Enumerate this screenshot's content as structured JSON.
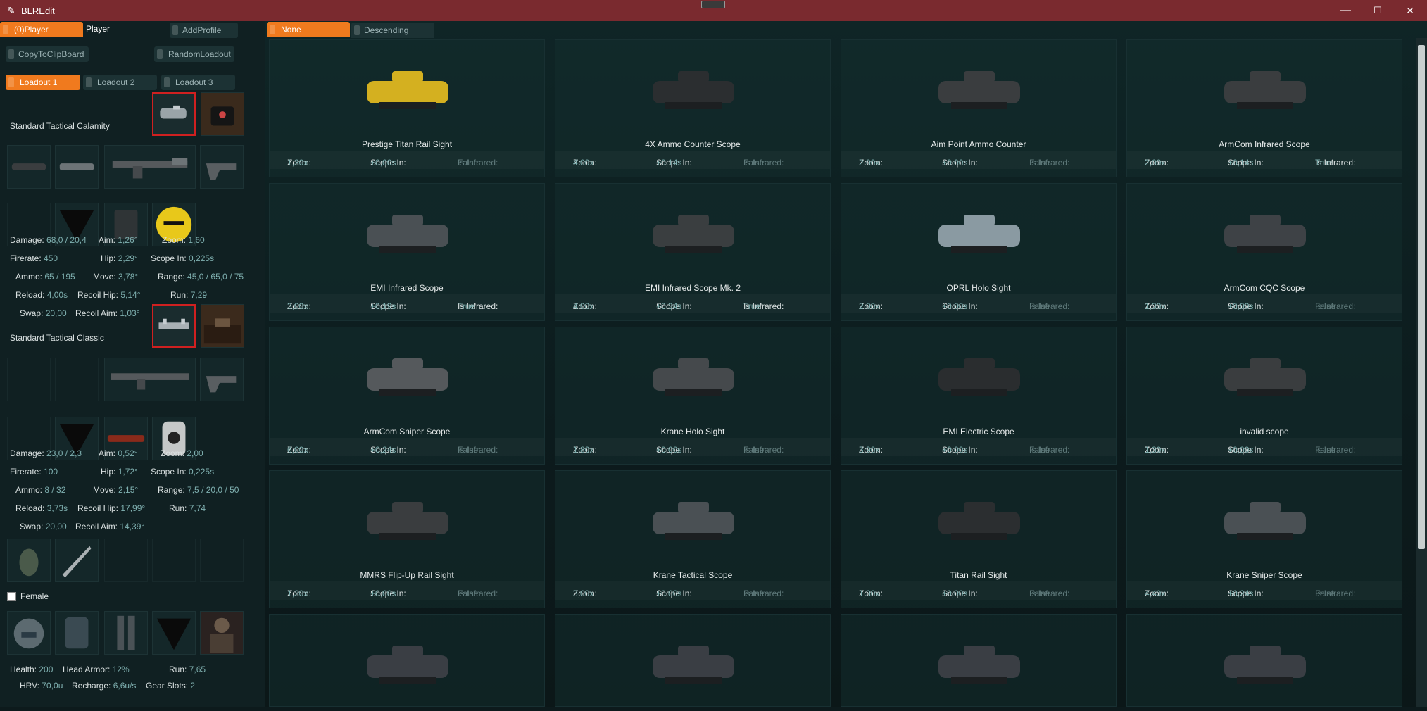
{
  "window": {
    "title": "BLREdit",
    "min": "—",
    "max": "☐",
    "close": "✕"
  },
  "left": {
    "player_tab": "(0)Player",
    "player_label": "Player",
    "add_profile": "AddProfile",
    "copy": "CopyToClipBoard",
    "random": "RandomLoadout",
    "loadouts": [
      "Loadout 1",
      "Loadout 2",
      "Loadout 3"
    ],
    "primary": {
      "name": "Standard Tactical Calamity",
      "stats": {
        "damage": "68,0 / 20,4",
        "aim": "1,26°",
        "zoom": "1,60",
        "firerate": "450",
        "hip": "2,29°",
        "scopein": "0,225s",
        "ammo": "65 / 195",
        "move": "3,78°",
        "range": "45,0 / 65,0 / 75",
        "reload": "4,00s",
        "recoilhip": "5,14°",
        "run": "7,29",
        "swap": "20,00",
        "recoilaim": "1,03°"
      }
    },
    "secondary": {
      "name": "Standard Tactical Classic",
      "stats": {
        "damage": "23,0 / 2,3",
        "aim": "0,52°",
        "zoom": "2,00",
        "firerate": "100",
        "hip": "1,72°",
        "scopein": "0,225s",
        "ammo": "8 / 32",
        "move": "2,15°",
        "range": "7,5 / 20,0 / 50",
        "reload": "3,73s",
        "recoilhip": "17,99°",
        "run": "7,74",
        "swap": "20,00",
        "recoilaim": "14,39°"
      }
    },
    "labels": {
      "damage": "Damage:",
      "aim": "Aim:",
      "zoom": "Zoom:",
      "firerate": "Firerate:",
      "hip": "Hip:",
      "scopein": "Scope In:",
      "ammo": "Ammo:",
      "move": "Move:",
      "range": "Range:",
      "reload": "Reload:",
      "recoilhip": "Recoil Hip:",
      "run": "Run:",
      "swap": "Swap:",
      "recoilaim": "Recoil Aim:",
      "health": "Health:",
      "head": "Head Armor:",
      "hrv": "HRV:",
      "recharge": "Recharge:",
      "gear": "Gear Slots:"
    },
    "female": "Female",
    "gear": {
      "health": "200",
      "head": "12%",
      "run": "7,65",
      "hrv": "70,0u",
      "recharge": "6,6u/s",
      "gearslots": "2"
    }
  },
  "right": {
    "sort": "None",
    "order": "Descending",
    "zoom_label": "Zoom:",
    "scopein_label": "Scope In:",
    "infrared_label": "Is Infrared:",
    "items": [
      {
        "name": "Prestige Titan Rail Sight",
        "zoom": "1,30x",
        "scopein": "+0,00s",
        "ir": "False"
      },
      {
        "name": "4X Ammo Counter Scope",
        "zoom": "4,00x",
        "scopein": "+0,14s",
        "ir": "False"
      },
      {
        "name": "Aim Point Ammo Counter",
        "zoom": "2,00x",
        "scopein": "+0,00s",
        "ir": "False"
      },
      {
        "name": "ArmCom Infrared Scope",
        "zoom": "2,00x",
        "scopein": "+0,14s",
        "ir": "True"
      },
      {
        "name": "EMI Infrared Scope",
        "zoom": "3,00x",
        "scopein": "+0,19s",
        "ir": "True"
      },
      {
        "name": "EMI Infrared Scope Mk. 2",
        "zoom": "4,00x",
        "scopein": "+0,34s",
        "ir": "True"
      },
      {
        "name": "OPRL Holo Sight",
        "zoom": "2,00x",
        "scopein": "+0,00s",
        "ir": "False"
      },
      {
        "name": "ArmCom CQC Scope",
        "zoom": "1,30x",
        "scopein": "+0,00s",
        "ir": "False"
      },
      {
        "name": "ArmCom Sniper Scope",
        "zoom": "6,00x",
        "scopein": "+0,24s",
        "ir": "False"
      },
      {
        "name": "Krane Holo Sight",
        "zoom": "1,80x",
        "scopein": "+0,00s",
        "ir": "False"
      },
      {
        "name": "EMI Electric Scope",
        "zoom": "3,90x",
        "scopein": "+0,00s",
        "ir": "False"
      },
      {
        "name": "invalid scope",
        "zoom": "1,30x",
        "scopein": "+0,00s",
        "ir": "False"
      },
      {
        "name": "MMRS Flip-Up Rail Sight",
        "zoom": "1,30x",
        "scopein": "+0,00s",
        "ir": "False"
      },
      {
        "name": "Krane Tactical Scope",
        "zoom": "3,00x",
        "scopein": "+0,00s",
        "ir": "False"
      },
      {
        "name": "Titan Rail Sight",
        "zoom": "1,30x",
        "scopein": "+0,00s",
        "ir": "False"
      },
      {
        "name": "Krane Sniper Scope",
        "zoom": "4,40x",
        "scopein": "+0,24s",
        "ir": "False"
      },
      {
        "name": "",
        "zoom": "",
        "scopein": "",
        "ir": ""
      },
      {
        "name": "",
        "zoom": "",
        "scopein": "",
        "ir": ""
      },
      {
        "name": "",
        "zoom": "",
        "scopein": "",
        "ir": ""
      },
      {
        "name": "",
        "zoom": "",
        "scopein": "",
        "ir": ""
      }
    ]
  }
}
